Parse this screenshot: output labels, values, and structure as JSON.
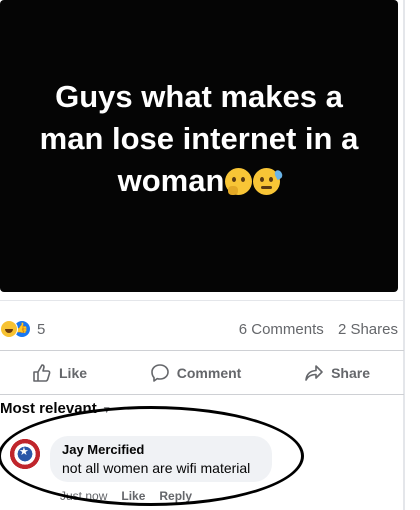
{
  "post": {
    "text": "Guys what makes a man lose internet in a woman",
    "emojis": [
      "thinking-face",
      "downcast-sweat-face"
    ],
    "background": "#050505"
  },
  "stats": {
    "reaction_count": "5",
    "comments": "6 Comments",
    "shares": "2 Shares"
  },
  "actions": {
    "like": "Like",
    "comment": "Comment",
    "share": "Share"
  },
  "comments_section": {
    "sort_label": "Most relevant",
    "items": [
      {
        "author": "Jay Mercified",
        "text": "not all women are wifi material",
        "time": "Just now",
        "like": "Like",
        "reply": "Reply"
      }
    ]
  },
  "colors": {
    "accent": "#1877f2",
    "muted_text": "#65676b",
    "bubble": "#f0f2f5"
  }
}
